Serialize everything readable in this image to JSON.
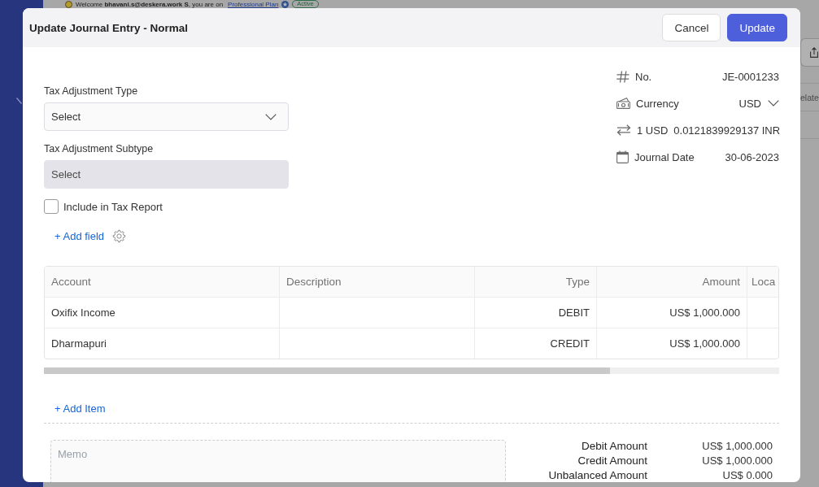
{
  "background": {
    "welcome": {
      "text": "Welcome **bhavani.s@deskera.work S**, you are on",
      "plan_link": "Professional Plan",
      "status": "Active"
    },
    "tab_label": "elate"
  },
  "dialog": {
    "title": "Update Journal Entry - Normal",
    "buttons": [
      {
        "label": "Cancel",
        "kind": "secondary"
      },
      {
        "label": "Update",
        "kind": "primary"
      }
    ]
  },
  "form": {
    "fields": [
      {
        "label": "Tax Adjustment Type",
        "placeholder": "Select",
        "disabled": false
      },
      {
        "label": "Tax Adjustment Subtype",
        "placeholder": "Select",
        "disabled": true
      }
    ],
    "include_in_tax_report": {
      "label": "Include in Tax Report",
      "checked": false
    },
    "add_field": "+ Add field"
  },
  "details": [
    {
      "kind": "number",
      "label": "No.",
      "value": "JE-0001233"
    },
    {
      "kind": "currency",
      "label": "Currency",
      "value": "USD"
    },
    {
      "kind": "exchange_rate",
      "label": "1 USD",
      "value": "0.0121839929137 INR"
    },
    {
      "kind": "date",
      "label": "Journal Date",
      "value": "30-06-2023"
    }
  ],
  "table": {
    "columns": [
      "Account",
      "Description",
      "Type",
      "Amount",
      "Loca"
    ],
    "rows": [
      {
        "account": "Oxifix Income",
        "type": "DEBIT",
        "amount": "US$ 1,000.000"
      },
      {
        "account": "Dharmapuri",
        "type": "CREDIT",
        "amount": "US$ 1,000.000"
      }
    ]
  },
  "add_item": "+ Add Item",
  "memo": {
    "placeholder": "Memo"
  },
  "totals": [
    {
      "label": "Debit Amount",
      "value": "US$ 1,000.000"
    },
    {
      "label": "Credit Amount",
      "value": "US$ 1,000.000"
    },
    {
      "label": "Unbalanced Amount",
      "value": "US$ 0.000"
    }
  ]
}
